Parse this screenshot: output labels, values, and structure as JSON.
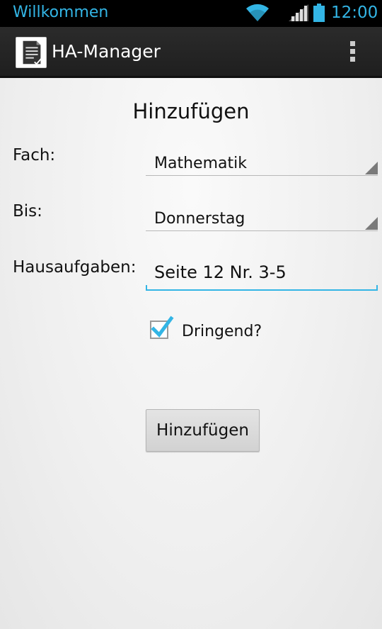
{
  "status_bar": {
    "notification_text": "Willkommen",
    "time": "12:00",
    "accent_color": "#33b5e5",
    "icons": [
      "wifi-icon",
      "signal-icon",
      "battery-icon"
    ]
  },
  "action_bar": {
    "title": "HA-Manager",
    "app_icon": "document-check-icon",
    "overflow_icon": "overflow-menu-icon"
  },
  "form": {
    "heading": "Hinzufügen",
    "subject_label": "Fach:",
    "subject_value": "Mathematik",
    "due_label": "Bis:",
    "due_value": "Donnerstag",
    "homework_label": "Hausaufgaben:",
    "homework_value": "Seite 12 Nr. 3-5",
    "urgent_label": "Dringend?",
    "urgent_checked": true,
    "submit_label": "Hinzufügen"
  }
}
